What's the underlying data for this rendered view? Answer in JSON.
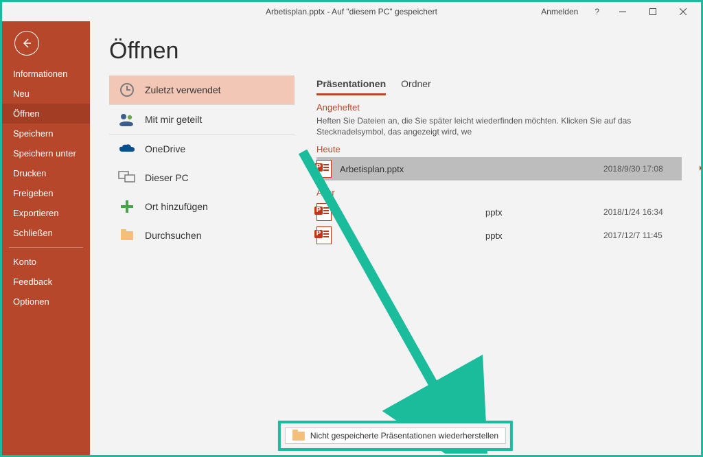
{
  "titlebar": {
    "title": "Arbetisplan.pptx  -  Auf \"diesem PC\" gespeichert",
    "signin": "Anmelden",
    "help": "?"
  },
  "sidebar": {
    "items": [
      {
        "label": "Informationen"
      },
      {
        "label": "Neu"
      },
      {
        "label": "Öffnen",
        "active": true
      },
      {
        "label": "Speichern"
      },
      {
        "label": "Speichern unter"
      },
      {
        "label": "Drucken"
      },
      {
        "label": "Freigeben"
      },
      {
        "label": "Exportieren"
      },
      {
        "label": "Schließen"
      }
    ],
    "bottom": [
      {
        "label": "Konto"
      },
      {
        "label": "Feedback"
      },
      {
        "label": "Optionen"
      }
    ]
  },
  "main": {
    "heading": "Öffnen",
    "locations": [
      {
        "label": "Zuletzt verwendet",
        "icon": "clock",
        "active": true
      },
      {
        "label": "Mit mir geteilt",
        "icon": "people"
      },
      {
        "label": "OneDrive",
        "icon": "cloud"
      },
      {
        "label": "Dieser PC",
        "icon": "pc"
      },
      {
        "label": "Ort hinzufügen",
        "icon": "plus"
      },
      {
        "label": "Durchsuchen",
        "icon": "folder"
      }
    ],
    "tabs": {
      "presentations": "Präsentationen",
      "folders": "Ordner"
    },
    "pinned": {
      "title": "Angeheftet",
      "help": "Heften Sie Dateien an, die Sie später leicht wiederfinden möchten. Klicken Sie auf das Stecknadelsymbol, das angezeigt wird, we"
    },
    "groups": [
      {
        "title": "Heute",
        "rows": [
          {
            "name": "Arbetisplan.pptx",
            "ext": "",
            "date": "2018/9/30 17:08",
            "selected": true,
            "pinned": true
          }
        ]
      },
      {
        "title": "Älter",
        "rows": [
          {
            "name": "",
            "ext": "pptx",
            "date": "2018/1/24 16:34"
          },
          {
            "name": "",
            "ext": "pptx",
            "date": "2017/12/7 11:45"
          }
        ]
      }
    ],
    "recover": "Nicht gespeicherte Präsentationen wiederherstellen"
  }
}
